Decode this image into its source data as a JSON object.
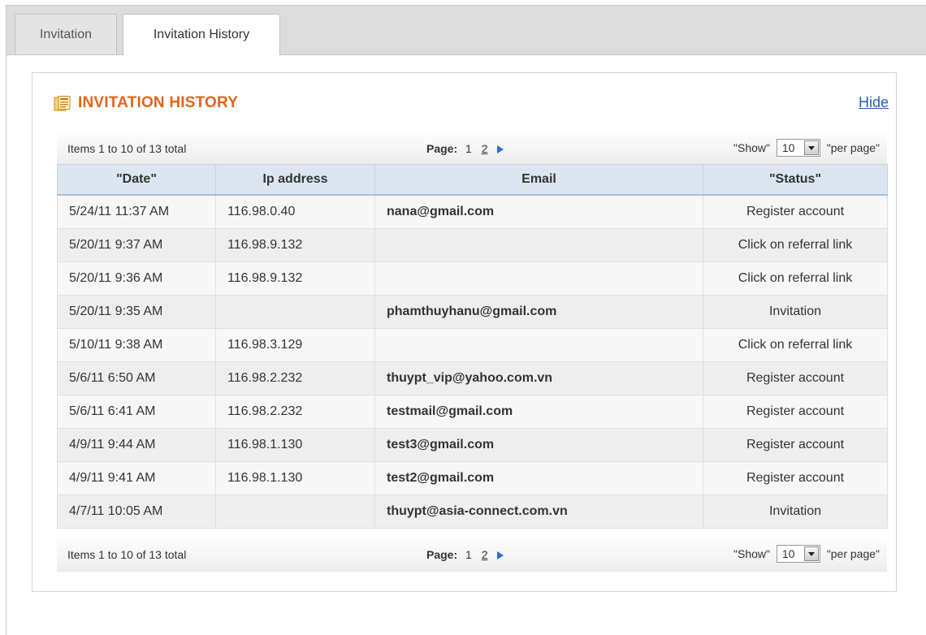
{
  "tabs": [
    {
      "label": "Invitation"
    },
    {
      "label": "Invitation History"
    }
  ],
  "panel": {
    "title": "INVITATION HISTORY",
    "hide_label": "Hide",
    "icon": "document-list-icon"
  },
  "pager": {
    "items_text": "Items 1 to 10 of 13 total",
    "page_label": "Page:",
    "current_page": "1",
    "other_page": "2",
    "show_label": "\"Show\"",
    "per_page_value": "10",
    "per_page_label": "\"per page\""
  },
  "table": {
    "columns": [
      "\"Date\"",
      "Ip address",
      "Email",
      "\"Status\""
    ],
    "rows": [
      {
        "date": "5/24/11 11:37 AM",
        "ip": "116.98.0.40",
        "email": "nana@gmail.com",
        "status": "Register account"
      },
      {
        "date": "5/20/11 9:37 AM",
        "ip": "116.98.9.132",
        "email": "",
        "status": "Click on referral link"
      },
      {
        "date": "5/20/11 9:36 AM",
        "ip": "116.98.9.132",
        "email": "",
        "status": "Click on referral link"
      },
      {
        "date": "5/20/11 9:35 AM",
        "ip": "",
        "email": "phamthuyhanu@gmail.com",
        "status": "Invitation"
      },
      {
        "date": "5/10/11 9:38 AM",
        "ip": "116.98.3.129",
        "email": "",
        "status": "Click on referral link"
      },
      {
        "date": "5/6/11 6:50 AM",
        "ip": "116.98.2.232",
        "email": "thuypt_vip@yahoo.com.vn",
        "status": "Register account"
      },
      {
        "date": "5/6/11 6:41 AM",
        "ip": "116.98.2.232",
        "email": "testmail@gmail.com",
        "status": "Register account"
      },
      {
        "date": "4/9/11 9:44 AM",
        "ip": "116.98.1.130",
        "email": "test3@gmail.com",
        "status": "Register account"
      },
      {
        "date": "4/9/11 9:41 AM",
        "ip": "116.98.1.130",
        "email": "test2@gmail.com",
        "status": "Register account"
      },
      {
        "date": "4/7/11 10:05 AM",
        "ip": "",
        "email": "thuypt@asia-connect.com.vn",
        "status": "Invitation"
      }
    ]
  },
  "colors": {
    "title": "#e2651b",
    "link": "#2a5fb8",
    "header_bg": "#dde6f0",
    "next_arrow": "#2a6fc9"
  }
}
